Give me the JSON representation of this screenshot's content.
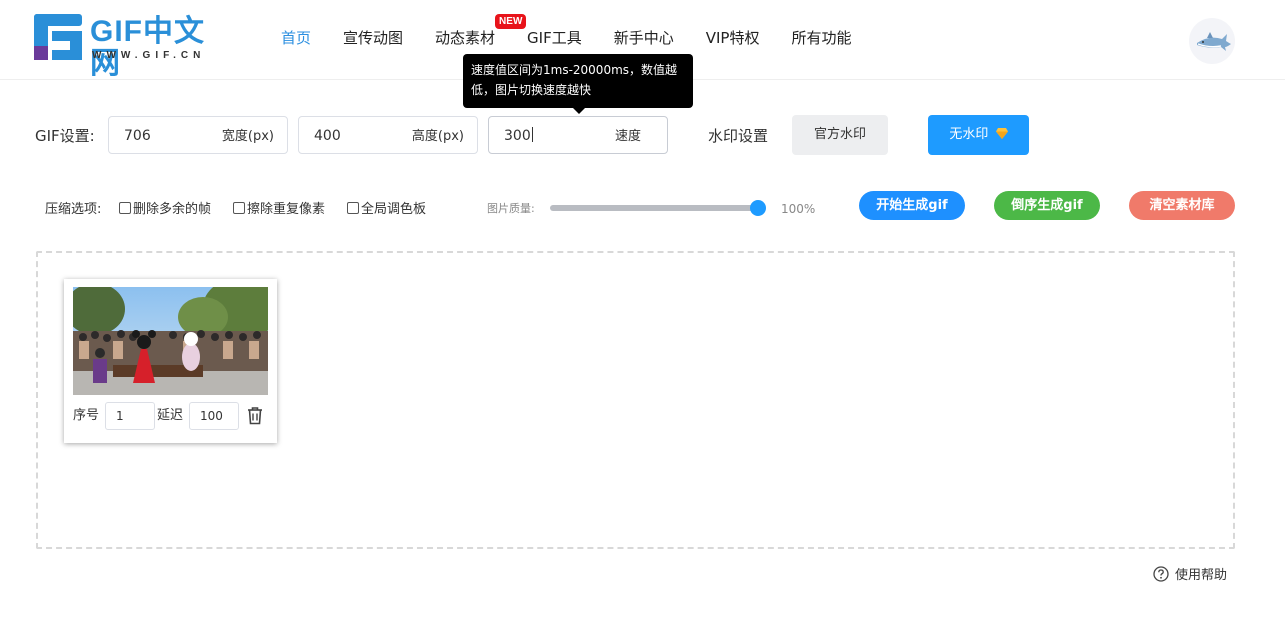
{
  "header": {
    "logo_text": "GIF中文网",
    "logo_domain": "WWW.GIF.CN",
    "nav": [
      {
        "label": "首页",
        "active": true
      },
      {
        "label": "宣传动图",
        "active": false
      },
      {
        "label": "动态素材",
        "active": false
      },
      {
        "label": "GIF工具",
        "active": false,
        "badge": "NEW"
      },
      {
        "label": "新手中心",
        "active": false
      },
      {
        "label": "VIP特权",
        "active": false
      },
      {
        "label": "所有功能",
        "active": false
      }
    ]
  },
  "tooltip": {
    "text": "速度值区间为1ms-20000ms，数值越低，图片切换速度越快"
  },
  "settings": {
    "label": "GIF设置:",
    "width": {
      "value": "706",
      "unit": "宽度(px)"
    },
    "height": {
      "value": "400",
      "unit": "高度(px)"
    },
    "speed": {
      "value": "300",
      "unit": "速度"
    },
    "watermark_label": "水印设置",
    "official_watermark": "官方水印",
    "no_watermark": "无水印"
  },
  "compression": {
    "label": "压缩选项:",
    "options": [
      {
        "label": "删除多余的帧",
        "checked": false
      },
      {
        "label": "擦除重复像素",
        "checked": false
      },
      {
        "label": "全局调色板",
        "checked": false
      }
    ],
    "quality_label": "图片质量:",
    "quality_value": "100%",
    "quality_fraction": 1.0
  },
  "actions": {
    "start": "开始生成gif",
    "reverse": "倒序生成gif",
    "clear": "清空素材库"
  },
  "frames": [
    {
      "order_label": "序号",
      "order": "1",
      "delay_label": "延迟",
      "delay": "100"
    }
  ],
  "help": {
    "label": "使用帮助"
  },
  "colors": {
    "accent": "#1e9bff",
    "logo": "#2a8fd8",
    "green": "#4cb847",
    "red": "#f07a6a",
    "badge": "#e8131a"
  },
  "icons": [
    "help-circle-icon",
    "trash-icon",
    "diamond-icon"
  ]
}
